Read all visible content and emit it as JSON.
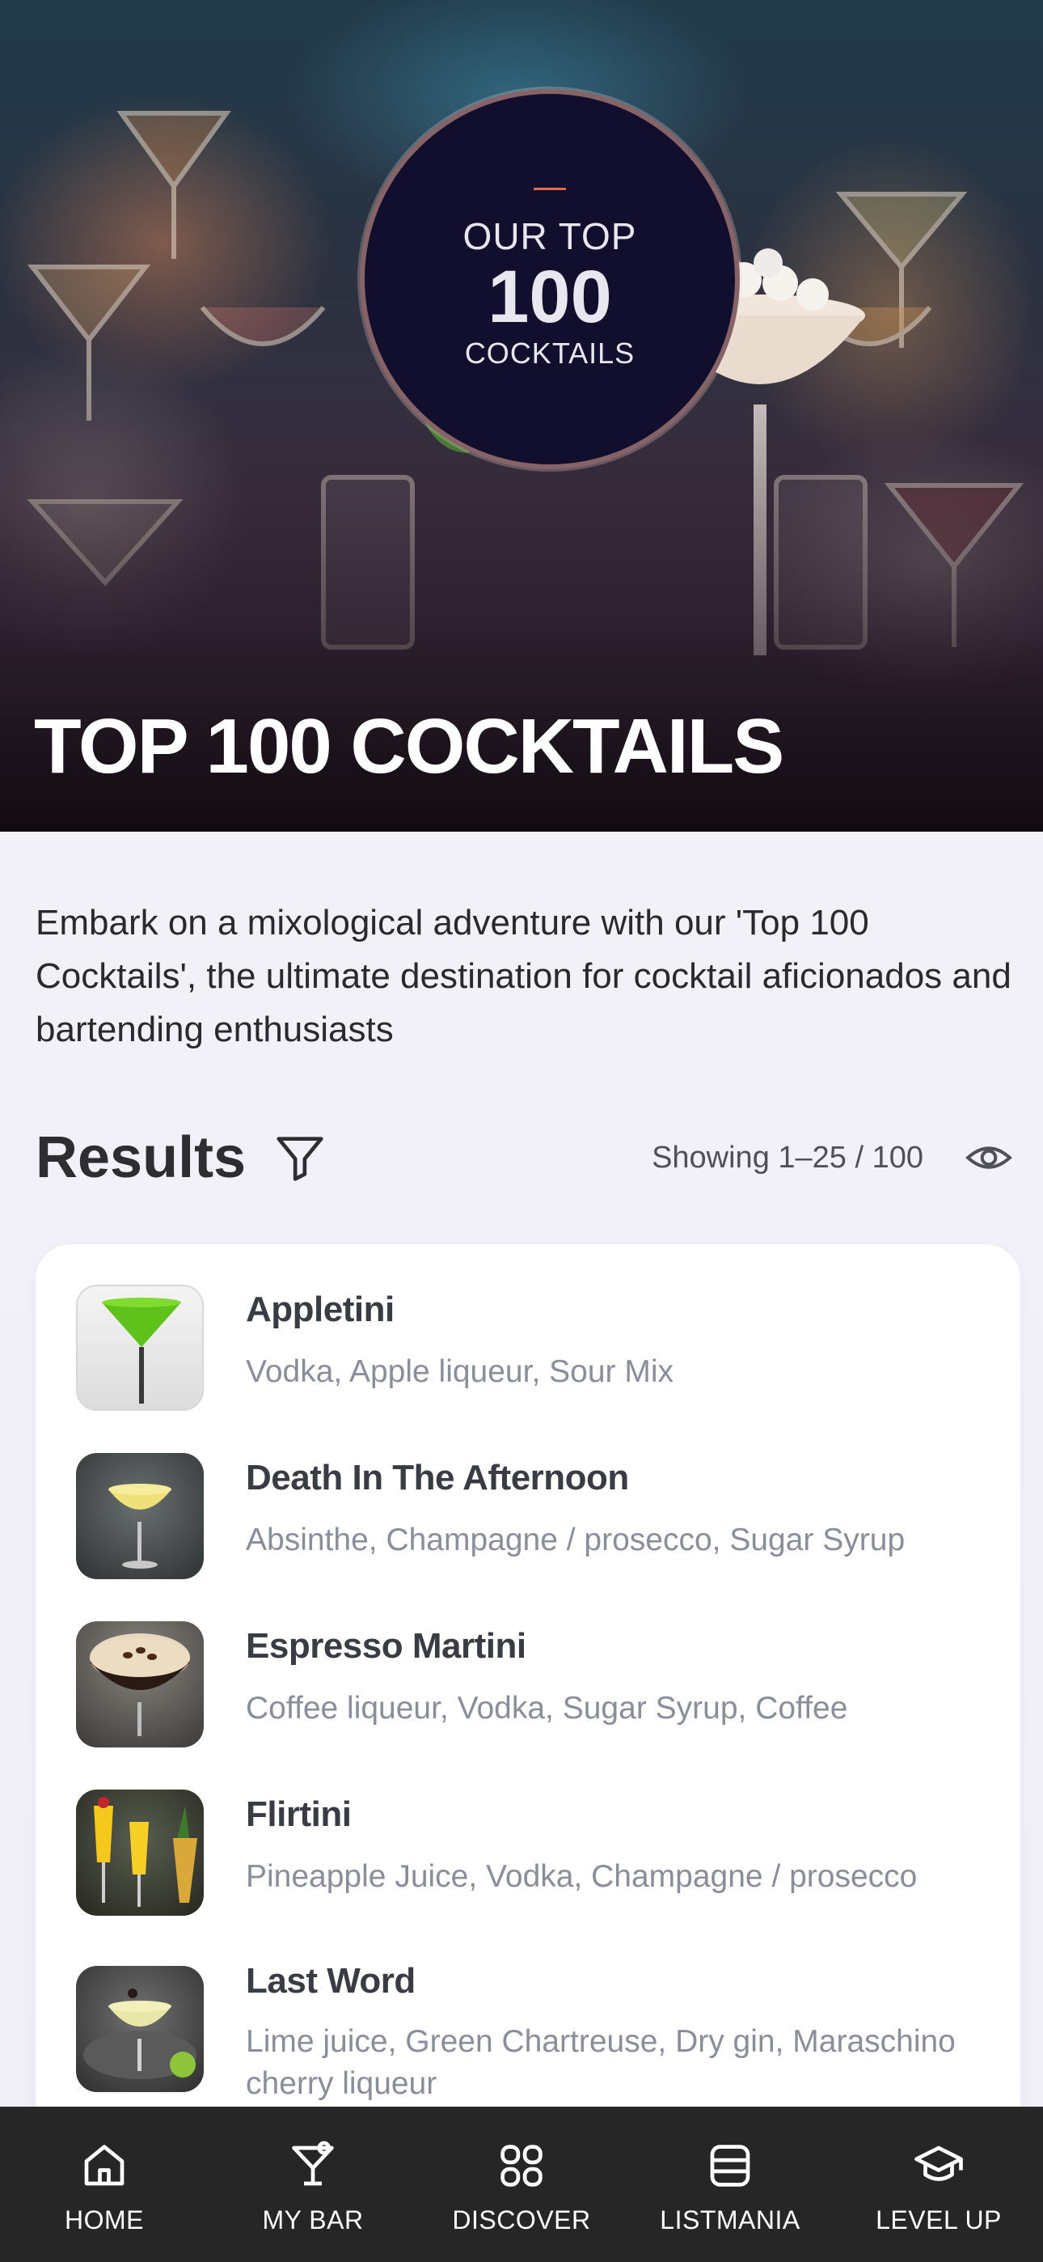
{
  "hero": {
    "badge_line1": "OUR TOP",
    "badge_line2": "100",
    "badge_line3": "COCKTAILS",
    "title": "TOP 100 COCKTAILS"
  },
  "description": "Embark on a mixological adventure with our 'Top 100 Cocktails', the ultimate destination for cocktail aficionados and bartending enthusiasts",
  "results": {
    "title": "Results",
    "showing": "Showing 1–25 / 100"
  },
  "cocktails": [
    {
      "name": "Appletini",
      "ingredients": "Vodka, Apple liqueur, Sour Mix",
      "image": "green-martini"
    },
    {
      "name": "Death In The Afternoon",
      "ingredients": "Absinthe, Champagne / prosecco, Sugar Syrup",
      "image": "coupe-yellow"
    },
    {
      "name": "Espresso Martini",
      "ingredients": "Coffee liqueur, Vodka, Sugar Syrup, Coffee",
      "image": "espresso-coupe"
    },
    {
      "name": "Flirtini",
      "ingredients": "Pineapple Juice, Vodka, Champagne / prosecco",
      "image": "champagne-flutes"
    },
    {
      "name": "Last Word",
      "ingredients": "Lime juice, Green Chartreuse, Dry gin, Maraschino cherry liqueur",
      "image": "coupe-green-lime"
    }
  ],
  "nav": [
    {
      "label": "HOME",
      "icon": "home-icon"
    },
    {
      "label": "MY BAR",
      "icon": "cocktail-glass-icon"
    },
    {
      "label": "DISCOVER",
      "icon": "grid-icon"
    },
    {
      "label": "LISTMANIA",
      "icon": "list-icon"
    },
    {
      "label": "LEVEL UP",
      "icon": "graduation-cap-icon"
    }
  ]
}
